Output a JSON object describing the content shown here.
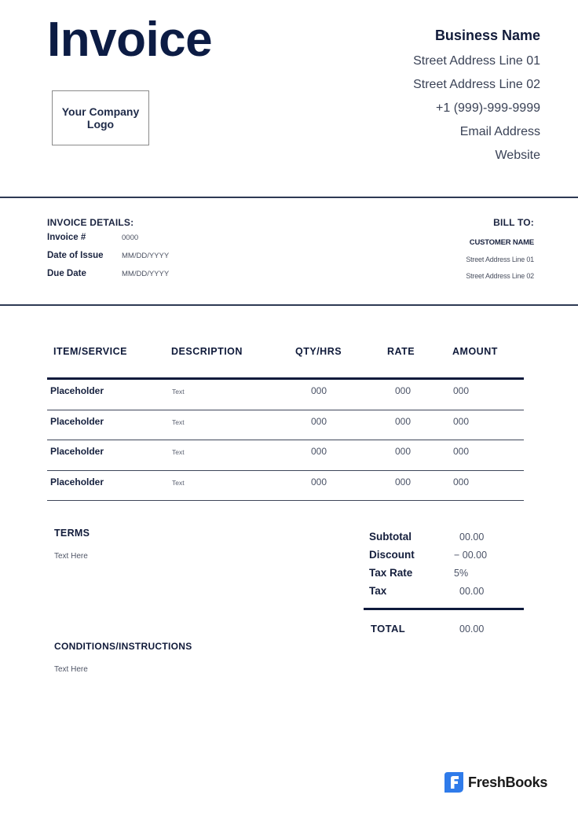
{
  "header": {
    "title": "Invoice",
    "logo_placeholder": "Your Company Logo"
  },
  "business": {
    "name": "Business Name",
    "address_line_1": "Street Address Line 01",
    "address_line_2": "Street Address Line 02",
    "phone": "+1 (999)-999-9999",
    "email": "Email Address",
    "website": "Website"
  },
  "invoice_details": {
    "heading": "INVOICE DETAILS:",
    "rows": [
      {
        "label": "Invoice #",
        "value": "0000"
      },
      {
        "label": "Date of Issue",
        "value": "MM/DD/YYYY"
      },
      {
        "label": "Due Date",
        "value": "MM/DD/YYYY"
      }
    ]
  },
  "bill_to": {
    "heading": "BILL TO:",
    "customer_name": "CUSTOMER NAME",
    "address_line_1": "Street Address Line 01",
    "address_line_2": "Street Address Line 02"
  },
  "items_table": {
    "columns": [
      "ITEM/SERVICE",
      "DESCRIPTION",
      "QTY/HRS",
      "RATE",
      "AMOUNT"
    ],
    "rows": [
      {
        "item": "Placeholder",
        "description": "Text",
        "qty": "000",
        "rate": "000",
        "amount": "000"
      },
      {
        "item": "Placeholder",
        "description": "Text",
        "qty": "000",
        "rate": "000",
        "amount": "000"
      },
      {
        "item": "Placeholder",
        "description": "Text",
        "qty": "000",
        "rate": "000",
        "amount": "000"
      },
      {
        "item": "Placeholder",
        "description": "Text",
        "qty": "000",
        "rate": "000",
        "amount": "000"
      }
    ]
  },
  "terms": {
    "heading": "TERMS",
    "text": "Text Here"
  },
  "conditions": {
    "heading": "CONDITIONS/INSTRUCTIONS",
    "text": "Text Here"
  },
  "totals": {
    "rows": [
      {
        "label": "Subtotal",
        "value": "00.00"
      },
      {
        "label": "Discount",
        "value": "− 00.00"
      },
      {
        "label": "Tax Rate",
        "value": "5%"
      },
      {
        "label": "Tax",
        "value": "00.00"
      }
    ],
    "total_label": "TOTAL",
    "total_value": "00.00"
  },
  "brand": {
    "icon": "freshbooks-f-icon",
    "name": "FreshBooks",
    "color": "#2f7bea"
  }
}
